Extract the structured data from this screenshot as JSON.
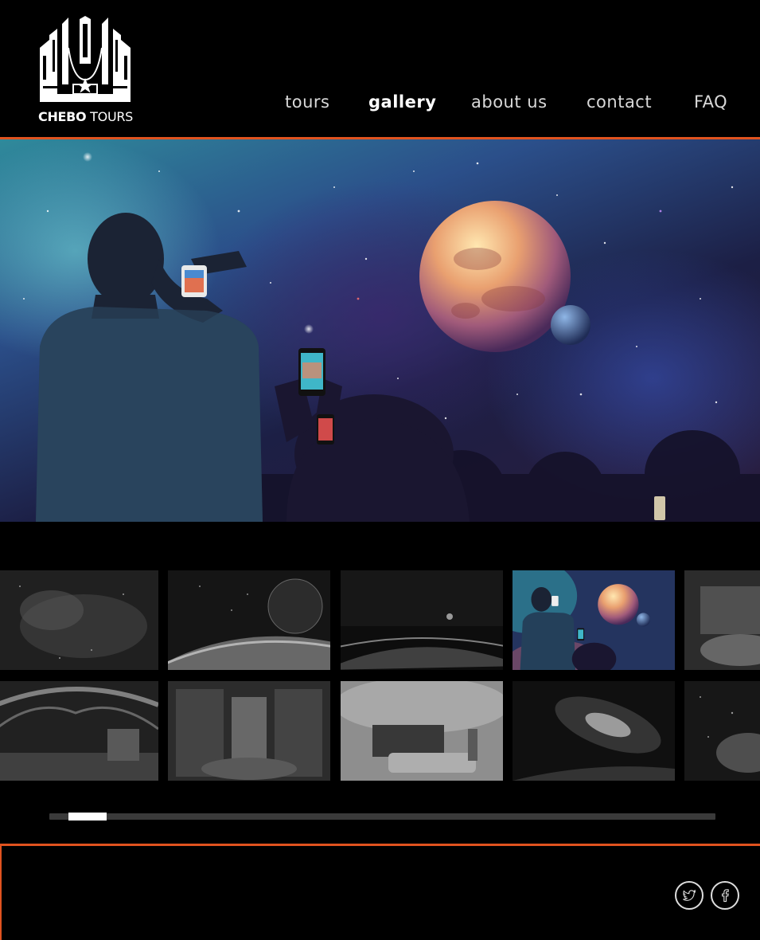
{
  "brand": {
    "name_bold": "CHEBO",
    "name_light": "TOURS",
    "icon": "chebo-tours-logo"
  },
  "nav": {
    "items": [
      {
        "label": "tours",
        "active": false
      },
      {
        "label": "gallery",
        "active": true
      },
      {
        "label": "about us",
        "active": false
      },
      {
        "label": "contact",
        "active": false
      },
      {
        "label": "FAQ",
        "active": false
      }
    ]
  },
  "colors": {
    "accent": "#e0531f",
    "background": "#000000",
    "scroll_track": "#3a3a3a",
    "scroll_thumb": "#ffffff"
  },
  "hero": {
    "image": "people-photographing-planet-in-space"
  },
  "gallery": {
    "rows": [
      [
        "nebula",
        "planet-horizon",
        "space-horizon-moon",
        "people-photographing-planet",
        "spaceship-lounge-window"
      ],
      [
        "spaceship-arched-hall",
        "spaceship-atrium",
        "spaceship-bedroom",
        "spiral-galaxy",
        "star-cluster"
      ]
    ],
    "selected": "people-photographing-planet"
  },
  "scrollbar": {
    "position": 0.03
  },
  "footer": {
    "social": [
      "twitter-icon",
      "facebook-icon"
    ]
  }
}
